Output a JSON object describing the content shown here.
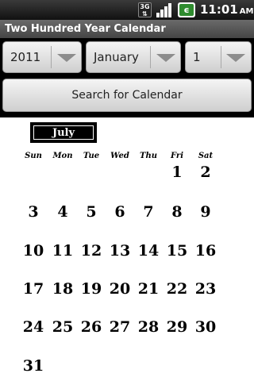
{
  "status_bar": {
    "network": "3G",
    "time": "11:01",
    "ampm": "AM"
  },
  "app": {
    "title": "Two Hundred Year Calendar"
  },
  "controls": {
    "year": "2011",
    "month": "January",
    "day": "1",
    "search_label": "Search for Calendar"
  },
  "calendar": {
    "month_name": "July",
    "weekdays": [
      "Sun",
      "Mon",
      "Tue",
      "Wed",
      "Thu",
      "Fri",
      "Sat"
    ],
    "weeks": [
      [
        "",
        "",
        "",
        "",
        "",
        "1",
        "2"
      ],
      [
        "3",
        "4",
        "5",
        "6",
        "7",
        "8",
        "9"
      ],
      [
        "10",
        "11",
        "12",
        "13",
        "14",
        "15",
        "16"
      ],
      [
        "17",
        "18",
        "19",
        "20",
        "21",
        "22",
        "23"
      ],
      [
        "24",
        "25",
        "26",
        "27",
        "28",
        "29",
        "30"
      ],
      [
        "31",
        "",
        "",
        "",
        "",
        "",
        ""
      ]
    ]
  }
}
